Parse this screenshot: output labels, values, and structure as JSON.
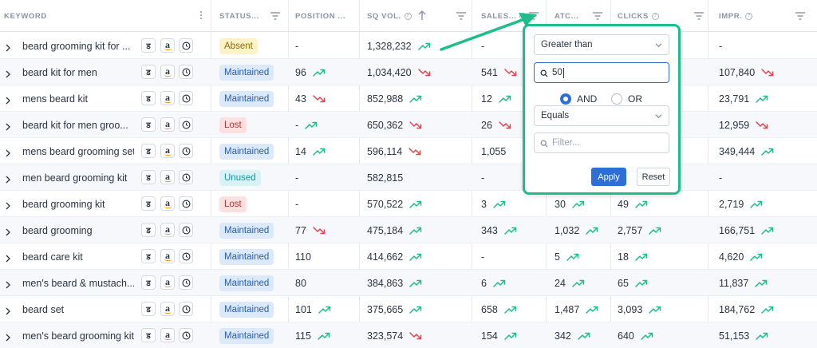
{
  "columns": [
    {
      "label": "KEYWORD",
      "has_info": false
    },
    {
      "label": "STATUS...",
      "has_info": false
    },
    {
      "label": "POSITION ...",
      "has_info": false
    },
    {
      "label": "SQ VOL.",
      "has_info": true
    },
    {
      "label": "SALES...",
      "has_info": true
    },
    {
      "label": "ATC...",
      "has_info": false
    },
    {
      "label": "CLICKS",
      "has_info": true
    },
    {
      "label": "IMPR.",
      "has_info": true
    }
  ],
  "row_buttons": [
    "ड",
    "a"
  ],
  "rows": [
    {
      "keyword": "beard grooming kit for ...",
      "status": "Absent",
      "status_type": "absent",
      "position": "-",
      "position_trend": "",
      "sqvol": "1,328,232",
      "sqvol_trend": "up",
      "sales": "-",
      "sales_trend": "",
      "atc": "",
      "atc_trend": "",
      "clicks": "",
      "clicks_trend": "",
      "impr": "-",
      "impr_trend": ""
    },
    {
      "keyword": "beard kit for men",
      "status": "Maintained",
      "status_type": "maint",
      "position": "96",
      "position_trend": "up",
      "sqvol": "1,034,420",
      "sqvol_trend": "down",
      "sales": "541",
      "sales_trend": "down",
      "atc": "",
      "atc_trend": "",
      "clicks": "",
      "clicks_trend": "",
      "impr": "107,840",
      "impr_trend": "down"
    },
    {
      "keyword": "mens beard kit",
      "status": "Maintained",
      "status_type": "maint",
      "position": "43",
      "position_trend": "down",
      "sqvol": "852,988",
      "sqvol_trend": "up",
      "sales": "12",
      "sales_trend": "up",
      "atc": "",
      "atc_trend": "",
      "clicks": "",
      "clicks_trend": "",
      "impr": "23,791",
      "impr_trend": "up"
    },
    {
      "keyword": "beard kit for men groo...",
      "status": "Lost",
      "status_type": "lost",
      "position": "-",
      "position_trend": "up",
      "sqvol": "650,362",
      "sqvol_trend": "down",
      "sales": "26",
      "sales_trend": "down",
      "atc": "",
      "atc_trend": "",
      "clicks": "",
      "clicks_trend": "",
      "impr": "12,959",
      "impr_trend": "down"
    },
    {
      "keyword": "mens beard grooming set",
      "status": "Maintained",
      "status_type": "maint",
      "position": "14",
      "position_trend": "up",
      "sqvol": "596,114",
      "sqvol_trend": "down",
      "sales": "1,055",
      "sales_trend": "",
      "atc": "",
      "atc_trend": "",
      "clicks": "",
      "clicks_trend": "",
      "impr": "349,444",
      "impr_trend": "up"
    },
    {
      "keyword": "men beard grooming kit",
      "status": "Unused",
      "status_type": "unused",
      "position": "-",
      "position_trend": "",
      "sqvol": "582,815",
      "sqvol_trend": "",
      "sales": "-",
      "sales_trend": "",
      "atc": "",
      "atc_trend": "",
      "clicks": "",
      "clicks_trend": "",
      "impr": "-",
      "impr_trend": ""
    },
    {
      "keyword": "beard grooming kit",
      "status": "Lost",
      "status_type": "lost",
      "position": "-",
      "position_trend": "",
      "sqvol": "570,522",
      "sqvol_trend": "up",
      "sales": "3",
      "sales_trend": "up",
      "atc": "30",
      "atc_trend": "up",
      "clicks": "49",
      "clicks_trend": "up",
      "impr": "2,719",
      "impr_trend": "up"
    },
    {
      "keyword": "beard grooming",
      "status": "Maintained",
      "status_type": "maint",
      "position": "77",
      "position_trend": "down",
      "sqvol": "475,184",
      "sqvol_trend": "up",
      "sales": "343",
      "sales_trend": "up",
      "atc": "1,032",
      "atc_trend": "up",
      "clicks": "2,757",
      "clicks_trend": "up",
      "impr": "166,751",
      "impr_trend": "up"
    },
    {
      "keyword": "beard care kit",
      "status": "Maintained",
      "status_type": "maint",
      "position": "110",
      "position_trend": "",
      "sqvol": "414,662",
      "sqvol_trend": "up",
      "sales": "-",
      "sales_trend": "",
      "atc": "5",
      "atc_trend": "up",
      "clicks": "18",
      "clicks_trend": "up",
      "impr": "4,620",
      "impr_trend": "up"
    },
    {
      "keyword": "men's beard & mustach...",
      "status": "Maintained",
      "status_type": "maint",
      "position": "80",
      "position_trend": "",
      "sqvol": "384,863",
      "sqvol_trend": "up",
      "sales": "6",
      "sales_trend": "up",
      "atc": "24",
      "atc_trend": "up",
      "clicks": "65",
      "clicks_trend": "up",
      "impr": "11,837",
      "impr_trend": "up"
    },
    {
      "keyword": "beard set",
      "status": "Maintained",
      "status_type": "maint",
      "position": "101",
      "position_trend": "up",
      "sqvol": "375,665",
      "sqvol_trend": "up",
      "sales": "658",
      "sales_trend": "up",
      "atc": "1,487",
      "atc_trend": "up",
      "clicks": "3,093",
      "clicks_trend": "up",
      "impr": "184,762",
      "impr_trend": "up"
    },
    {
      "keyword": "men's beard grooming kit",
      "status": "Maintained",
      "status_type": "maint",
      "position": "115",
      "position_trend": "up",
      "sqvol": "323,574",
      "sqvol_trend": "down",
      "sales": "154",
      "sales_trend": "up",
      "atc": "342",
      "atc_trend": "up",
      "clicks": "640",
      "clicks_trend": "up",
      "impr": "51,153",
      "impr_trend": "up"
    }
  ],
  "filter": {
    "condition1": "Greater than",
    "value1": "50",
    "and_label": "AND",
    "or_label": "OR",
    "selected_join": "AND",
    "condition2": "Equals",
    "placeholder2": "Filter...",
    "apply_label": "Apply",
    "reset_label": "Reset"
  },
  "colors": {
    "up": "#1dbd8c",
    "down": "#e0454f",
    "highlight": "#1dbd8c",
    "primary": "#2d6fd6"
  }
}
